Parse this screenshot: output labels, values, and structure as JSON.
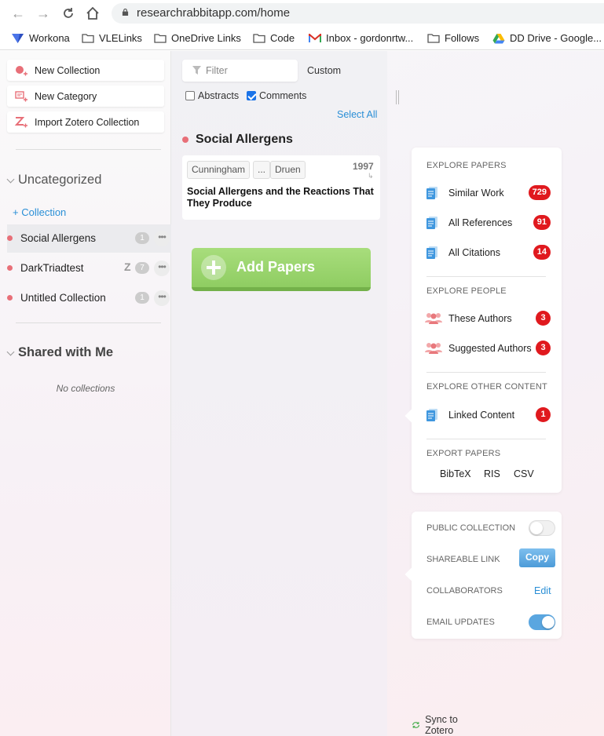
{
  "browser": {
    "url": "researchrabbitapp.com/home",
    "bookmarks": [
      "Workona",
      "VLELinks",
      "OneDrive Links",
      "Code",
      "Inbox - gordonrtw...",
      "Follows",
      "DD Drive - Google..."
    ]
  },
  "left": {
    "buttons": [
      "New Collection",
      "New Category",
      "Import Zotero Collection"
    ],
    "uncategorized_label": "Uncategorized",
    "add_collection": "+ Collection",
    "collections": [
      {
        "name": "Social Allergens",
        "count": "1",
        "zotero": ""
      },
      {
        "name": "DarkTriadtest",
        "count": "7",
        "zotero": "Z"
      },
      {
        "name": "Untitled Collection",
        "count": "1",
        "zotero": ""
      }
    ],
    "more_glyph": "•••",
    "shared_label": "Shared with Me",
    "no_collections": "No collections"
  },
  "middle": {
    "filter_placeholder": "Filter",
    "sort_label": "Custom",
    "abstracts_label": "Abstracts",
    "comments_label": "Comments",
    "select_all": "Select All",
    "collection_title": "Social Allergens",
    "paper": {
      "authors": [
        "Cunningham",
        "...",
        "Druen"
      ],
      "year": "1997",
      "title": "Social Allergens and the Reactions That They Produce"
    },
    "add_papers": "Add Papers",
    "sync": "Sync to Zotero"
  },
  "explore": {
    "papers_header": "EXPLORE PAPERS",
    "similar_work": "Similar Work",
    "similar_count": "729",
    "all_references": "All References",
    "references_count": "91",
    "all_citations": "All Citations",
    "citations_count": "14",
    "people_header": "EXPLORE PEOPLE",
    "these_authors": "These Authors",
    "these_count": "3",
    "suggested_authors": "Suggested Authors",
    "suggested_count": "3",
    "other_header": "EXPLORE OTHER CONTENT",
    "linked_content": "Linked Content",
    "linked_count": "1",
    "export_header": "EXPORT PAPERS",
    "bibtex": "BibTeX",
    "ris": "RIS",
    "csv": "CSV"
  },
  "settings": {
    "public_collection": "PUBLIC COLLECTION",
    "shareable_link": "SHAREABLE LINK",
    "copy": "Copy",
    "collaborators": "COLLABORATORS",
    "edit": "Edit",
    "email_updates": "EMAIL UPDATES"
  },
  "colors": {
    "accent": "#2a8fd6",
    "badge": "#e0191e",
    "add_green": "#8fcd62",
    "dot": "#e86f78"
  }
}
